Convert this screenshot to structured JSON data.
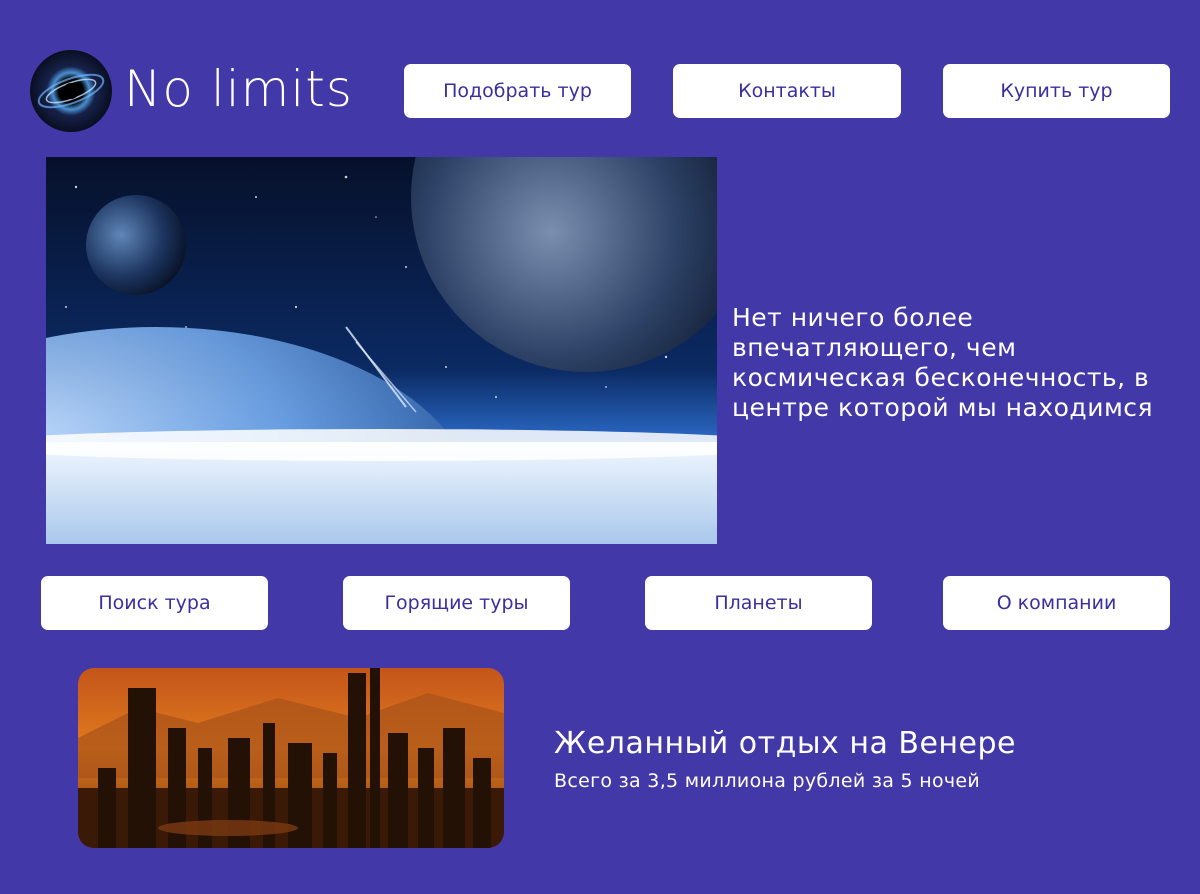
{
  "header": {
    "logo_icon": "black-hole-icon",
    "brand": "No limits",
    "nav": [
      {
        "label": "Подобрать тур"
      },
      {
        "label": "Контакты"
      },
      {
        "label": "Купить тур"
      }
    ]
  },
  "hero": {
    "image": "space-planets-image",
    "text": "Нет ничего более впечатляющего, чем космическая бесконечность, в центре которой мы находимся"
  },
  "menu": [
    {
      "label": "Поиск тура"
    },
    {
      "label": "Горящие туры"
    },
    {
      "label": "Планеты"
    },
    {
      "label": "О компании"
    }
  ],
  "promo": {
    "image": "venus-city-image",
    "title": "Желанный отдых на Венере",
    "subtitle": "Всего за 3,5 миллиона рублей за 5 ночей"
  },
  "colors": {
    "background": "#4338a8",
    "button_bg": "#ffffff",
    "button_text": "#3a2fa0"
  }
}
